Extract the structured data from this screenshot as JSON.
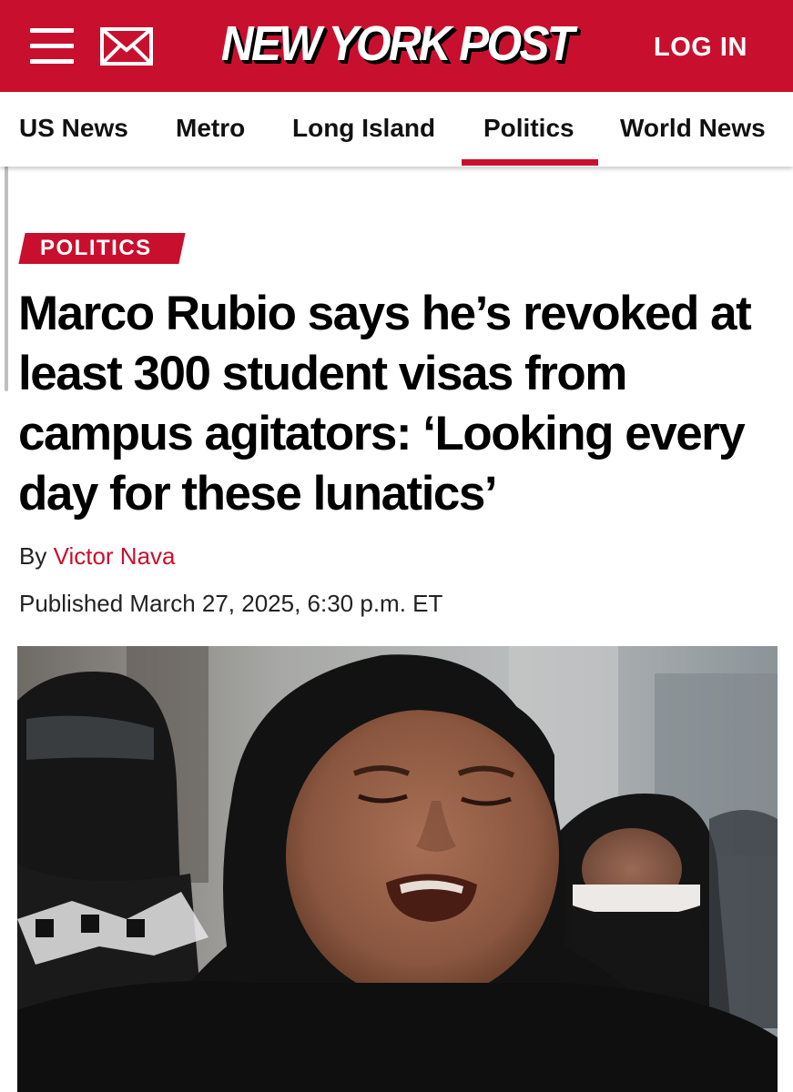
{
  "header": {
    "logo_text": "NEW YORK POST",
    "login_label": "LOG IN",
    "menu_icon": "hamburger-menu-icon",
    "mail_icon": "mail-icon",
    "brand_color": "#c8102e"
  },
  "nav": {
    "items": [
      {
        "label": "US News"
      },
      {
        "label": "Metro"
      },
      {
        "label": "Long Island"
      },
      {
        "label": "Politics",
        "active": true
      },
      {
        "label": "World News"
      }
    ]
  },
  "article": {
    "category": "POLITICS",
    "headline": "Marco Rubio says he’s revoked at least 300 student visas from campus agitators: ‘Looking every day for these lunatics’",
    "byline_prefix": "By",
    "author": "Victor Nava",
    "published": "Published March 27, 2025, 6:30 p.m. ET"
  }
}
